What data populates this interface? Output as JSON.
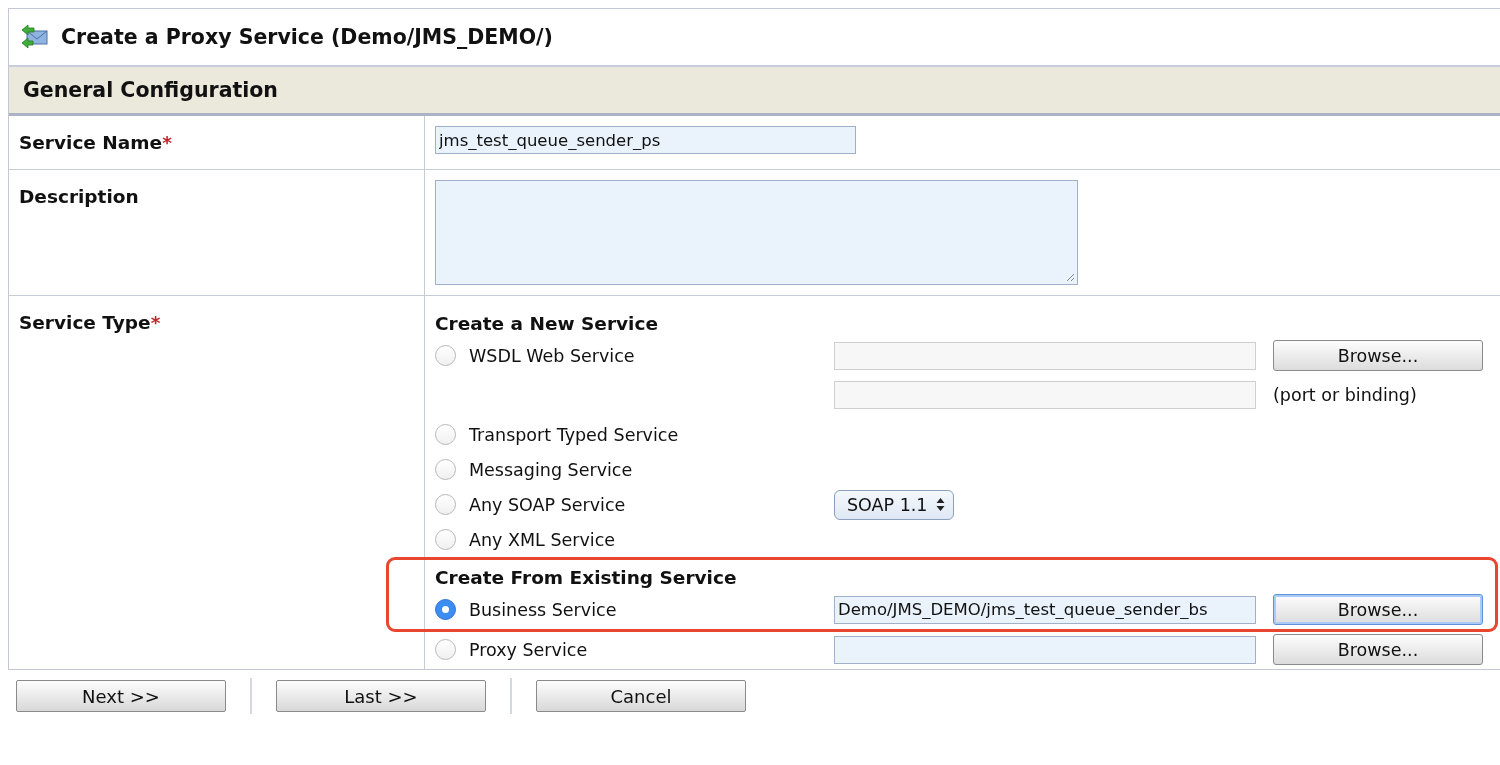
{
  "window": {
    "title": "Create a Proxy Service (Demo/JMS_DEMO/)"
  },
  "section": {
    "title": "General Configuration"
  },
  "service_name": {
    "label": "Service Name",
    "required_mark": "*",
    "value": "jms_test_queue_sender_ps"
  },
  "description": {
    "label": "Description"
  },
  "service_type": {
    "label": "Service Type",
    "required_mark": "*",
    "rows": [
      {
        "kind": "heading",
        "text": "Create a New Service",
        "highlighted": false
      },
      {
        "kind": "option",
        "label": "WSDL Web Service",
        "selected": false,
        "highlighted": false,
        "field": {
          "disabled": true
        },
        "button": {
          "label": "Browse...",
          "focused": false
        }
      },
      {
        "kind": "extra-field",
        "highlighted": false,
        "field": {
          "disabled": true
        },
        "note": "(port or binding)"
      },
      {
        "kind": "option",
        "label": "Transport Typed Service",
        "selected": false,
        "highlighted": false
      },
      {
        "kind": "option",
        "label": "Messaging Service",
        "selected": false,
        "highlighted": false
      },
      {
        "kind": "option",
        "label": "Any SOAP Service",
        "selected": false,
        "highlighted": false,
        "select": {
          "value": "SOAP 1.1"
        }
      },
      {
        "kind": "option",
        "label": "Any XML Service",
        "selected": false,
        "highlighted": false
      },
      {
        "kind": "heading",
        "text": "Create From Existing Service",
        "highlighted": true
      },
      {
        "kind": "option",
        "label": "Business Service",
        "selected": true,
        "highlighted": true,
        "field": {
          "disabled": false,
          "value": "Demo/JMS_DEMO/jms_test_queue_sender_bs"
        },
        "button": {
          "label": "Browse...",
          "focused": true
        }
      },
      {
        "kind": "option",
        "label": "Proxy Service",
        "selected": false,
        "highlighted": false,
        "field": {
          "disabled": false
        },
        "button": {
          "label": "Browse...",
          "focused": false
        }
      }
    ]
  },
  "buttons": [
    {
      "label": "Next >>"
    },
    {
      "label": "Last >>"
    },
    {
      "label": "Cancel"
    }
  ]
}
